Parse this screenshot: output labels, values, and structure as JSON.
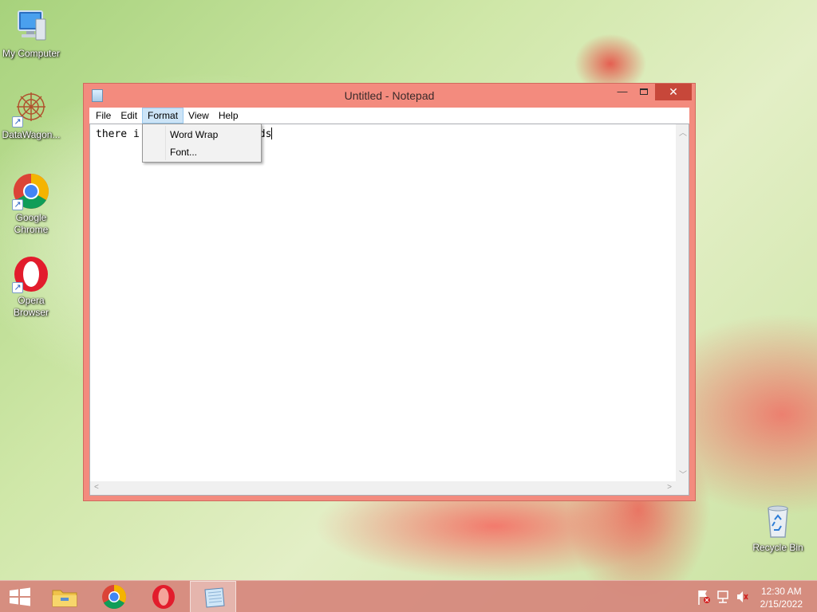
{
  "desktop": {
    "icons": [
      {
        "label": "My Computer",
        "icon": "computer-icon"
      },
      {
        "label": "DataWagon...",
        "icon": "datawagon-icon"
      },
      {
        "label": "Google Chrome",
        "icon": "chrome-icon"
      },
      {
        "label": "Opera Browser",
        "icon": "opera-icon"
      },
      {
        "label": "Recycle Bin",
        "icon": "recycle-bin-icon"
      }
    ]
  },
  "window": {
    "title": "Untitled - Notepad",
    "controls": {
      "minimize": "—",
      "maximize": "□",
      "close": "✕"
    },
    "menu": [
      "File",
      "Edit",
      "Format",
      "View",
      "Help"
    ],
    "active_menu": "Format",
    "editor_text": "there is text in words",
    "editor_text_visible_left": "there i",
    "editor_text_visible_right": "ds"
  },
  "format_menu": {
    "items": [
      "Word Wrap",
      "Font..."
    ]
  },
  "taskbar": {
    "buttons": [
      "start-icon",
      "file-explorer-icon",
      "chrome-icon",
      "opera-icon",
      "notepad-icon"
    ],
    "active": "notepad-icon",
    "tray_icons": [
      "action-center-flag-icon",
      "network-icon",
      "volume-muted-icon"
    ],
    "time": "12:30 AM",
    "date": "2/15/2022"
  },
  "colors": {
    "window_frame": "#f38b7e",
    "close_button": "#c7473a",
    "menu_highlight": "#cce4f7",
    "taskbar": "#d6867c"
  }
}
